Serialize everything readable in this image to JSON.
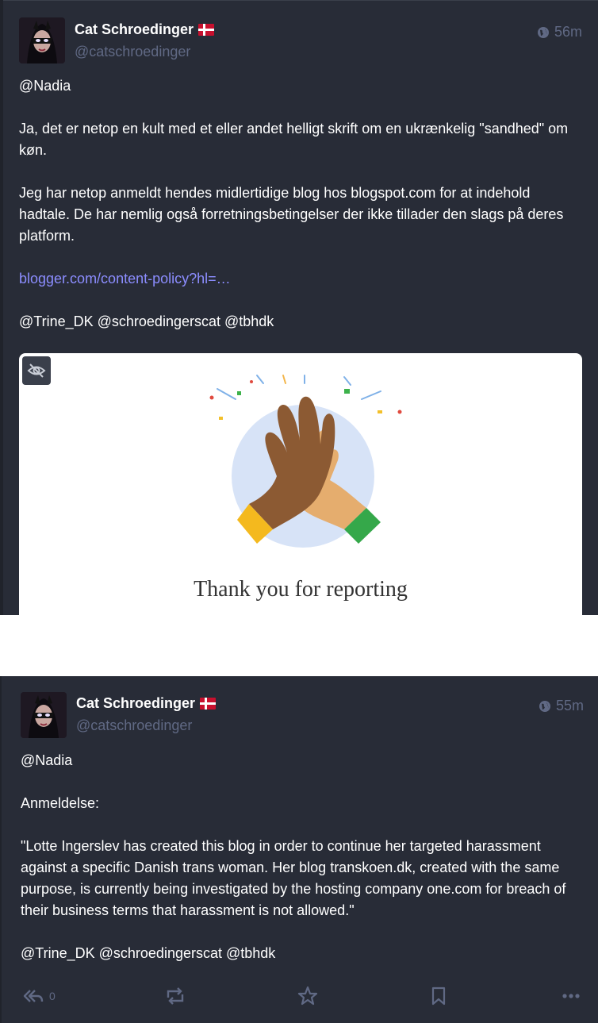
{
  "post1": {
    "display_name": "Cat Schroedinger",
    "handle": "@catschroedinger",
    "time": "56m",
    "paragraphs": [
      "@Nadia",
      "Ja, det er netop en kult med et eller andet helligt skrift om en ukrænkelig \"sandhed\" om køn.",
      "Jeg har netop anmeldt hendes midlertidige blog hos blogspot.com for at indehold hadtale. De har nemlig også forretningsbetingelser der ikke tillader den slags på deres platform."
    ],
    "link": "blogger.com/content-policy?hl=…",
    "mentions": "@Trine_DK @schroedingerscat @tbhdk",
    "media_caption": "Thank you for reporting"
  },
  "post2": {
    "display_name": "Cat Schroedinger",
    "handle": "@catschroedinger",
    "time": "55m",
    "paragraphs": [
      "@Nadia",
      "Anmeldelse:",
      "\"Lotte Ingerslev has created this blog in order to continue her targeted harassment against a specific Danish trans woman. Her blog transkoen.dk, created with the same purpose, is currently being investigated by the hosting company one.com for breach of their business terms that harassment is not allowed.\"",
      "@Trine_DK @schroedingerscat @tbhdk"
    ],
    "reply_count": "0"
  },
  "icons": [
    "globe-icon",
    "flag-dk-icon",
    "eye-slash-icon",
    "reply-all-icon",
    "boost-icon",
    "star-icon",
    "bookmark-icon",
    "more-icon"
  ],
  "colors": {
    "background": "#282c37",
    "muted": "#606984",
    "link": "#8c8dff",
    "text": "#ffffff"
  }
}
